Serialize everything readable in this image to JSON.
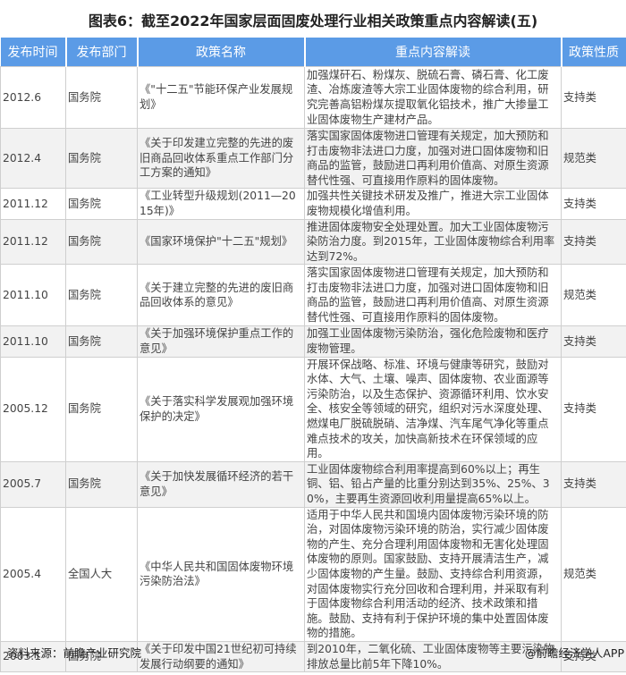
{
  "title": "图表6：截至2022年国家层面固废处理行业相关政策重点内容解读(五)",
  "headers": [
    "发布时间",
    "发布部门",
    "政策名称",
    "重点内容解读",
    "政策性质"
  ],
  "rows": [
    {
      "date": "2012.6",
      "dept": "国务院",
      "name": "《\"十二五\"节能环保产业发展规划》",
      "content": "加强煤矸石、粉煤灰、脱硫石膏、磷石膏、化工废渣、冶炼废渣等大宗工业固体废物的综合利用，研究完善高铝粉煤灰提取氧化铝技术，推广大掺量工业固体废物生产建材产品。",
      "type": "支持类"
    },
    {
      "date": "2012.4",
      "dept": "国务院",
      "name": "《关于印发建立完整的先进的废旧商品回收体系重点工作部门分工方案的通知》",
      "content": "落实国家固体废物进口管理有关规定，加大预防和打击废物非法进口力度，加强对进口固体废物和旧商品的监管，鼓励进口再利用价值高、对原生资源替代性强、可直接用作原料的固体废物。",
      "type": "规范类"
    },
    {
      "date": "2011.12",
      "dept": "国务院",
      "name": "《工业转型升级规划(2011—2015年)》",
      "content": "加强共性关键技术研发及推广，推进大宗工业固体废物规模化增值利用。",
      "type": "支持类"
    },
    {
      "date": "2011.12",
      "dept": "国务院",
      "name": "《国家环境保护\"十二五\"规划》",
      "content": "推进固体废物安全处理处置。加大工业固体废物污染防治力度。到2015年，工业固体废物综合利用率达到72%。",
      "type": "支持类"
    },
    {
      "date": "2011.10",
      "dept": "国务院",
      "name": "《关于建立完整的先进的废旧商品回收体系的意见》",
      "content": "落实国家固体废物进口管理有关规定，加大预防和打击废物非法进口力度，加强对进口固体废物和旧商品的监管，鼓励进口再利用价值高、对原生资源替代性强、可直接用作原料的固体废物。",
      "type": "规范类"
    },
    {
      "date": "2011.10",
      "dept": "国务院",
      "name": "《关于加强环境保护重点工作的意见》",
      "content": "加强工业固体废物污染防治，强化危险废物和医疗废物管理。",
      "type": "支持类"
    },
    {
      "date": "2005.12",
      "dept": "国务院",
      "name": "《关于落实科学发展观加强环境保护的决定》",
      "content": "开展环保战略、标准、环境与健康等研究，鼓励对水体、大气、土壤、噪声、固体废物、农业面源等污染防治，以及生态保护、资源循环利用、饮水安全、核安全等领域的研究，组织对污水深度处理、燃煤电厂脱硫脱硝、洁净煤、汽车尾气净化等重点难点技术的攻关，加快高新技术在环保领域的应用。",
      "type": "支持类"
    },
    {
      "date": "2005.7",
      "dept": "国务院",
      "name": "《关于加快发展循环经济的若干意见》",
      "content": "工业固体废物综合利用率提高到60%以上；再生铜、铝、铅占产量的比重分别达到35%、25%、30%，主要再生资源回收利用量提高65%以上。",
      "type": "支持类"
    },
    {
      "date": "2005.4",
      "dept": "全国人大",
      "name": "《中华人民共和国固体废物环境污染防治法》",
      "content": "适用于中华人民共和国境内固体废物污染环境的防治，对固体废物污染环境的防治，实行减少固体废物的产生、充分合理利用固体废物和无害化处理固体废物的原则。国家鼓励、支持开展清洁生产，减少固体废物的产生量。鼓励、支持综合利用资源，对固体废物实行充分回收和合理利用，并采取有利于固体废物综合利用活动的经济、技术政策和措施。鼓励、支持有利于保护环境的集中处置固体废物的措施。",
      "type": "规范类"
    },
    {
      "date": "2003.1",
      "dept": "国务院",
      "name": "《关于印发中国21世纪初可持续发展行动纲要的通知》",
      "content": "到2010年，二氧化硫、工业固体废物等主要污染物排放总量比前5年下降10%。",
      "type": "支持类"
    }
  ],
  "footer": {
    "source": "资料来源：前瞻产业研究院",
    "brand": "@前瞻经济学人APP"
  }
}
